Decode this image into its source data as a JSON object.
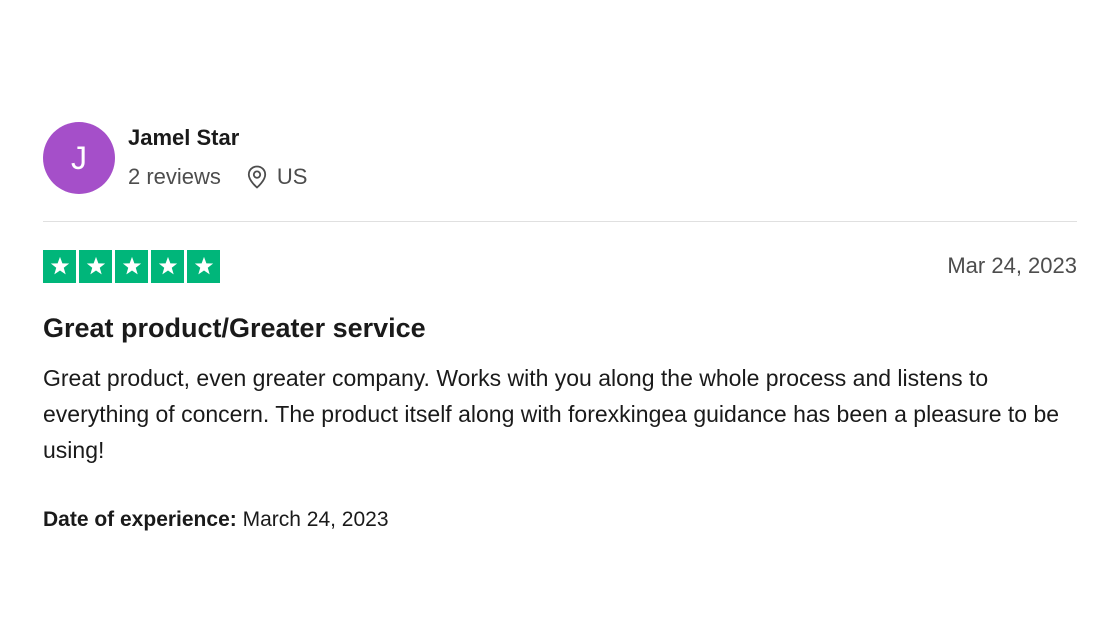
{
  "reviewer": {
    "initial": "J",
    "avatar_color": "#a54fc9",
    "name": "Jamel Star",
    "reviews_count": "2 reviews",
    "location": "US"
  },
  "review": {
    "rating": 5,
    "max_rating": 5,
    "star_color": "#00b67a",
    "date": "Mar 24, 2023",
    "title": "Great product/Greater service",
    "body": "Great product, even greater company. Works with you along the whole process and listens to everything of concern. The product itself along with forexkingea guidance has been a pleasure to be using!",
    "experience_label": "Date of experience:",
    "experience_date": "March 24, 2023"
  }
}
